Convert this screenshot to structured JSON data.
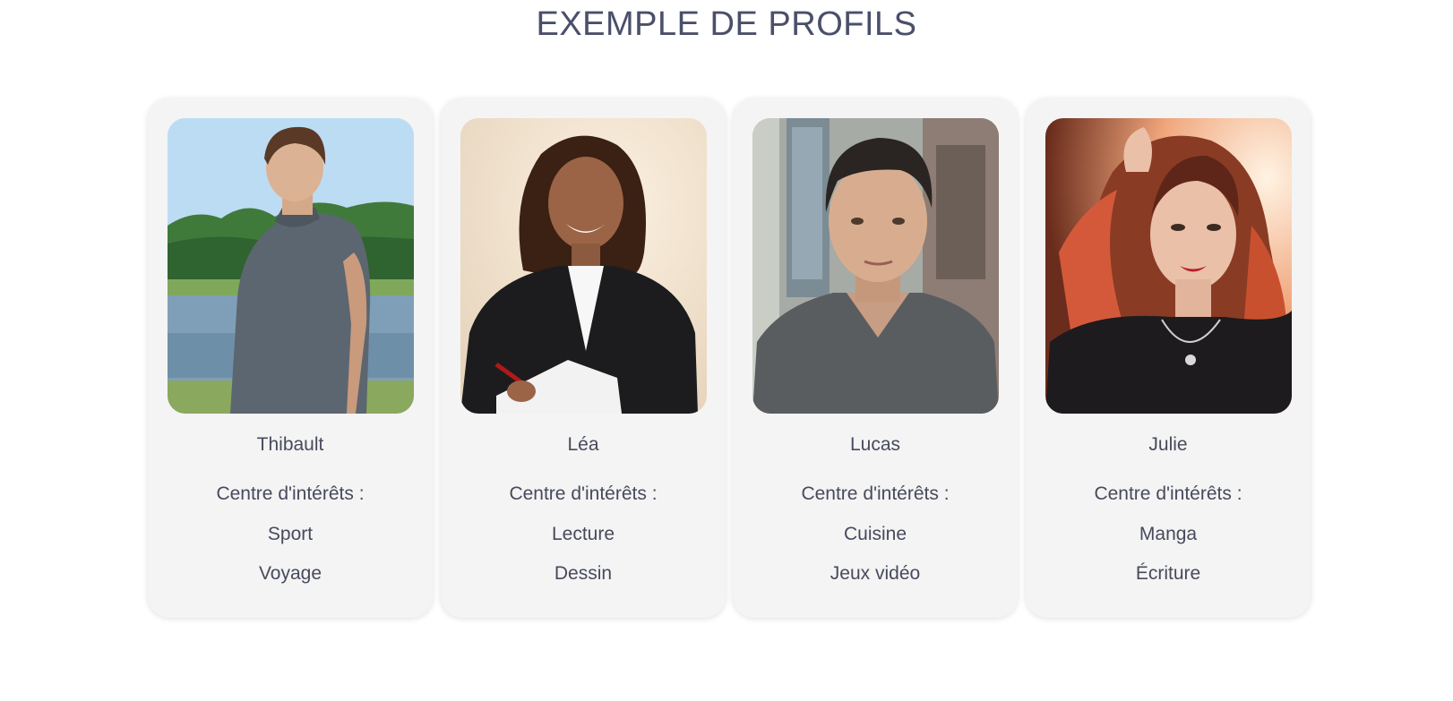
{
  "page": {
    "title": "EXEMPLE DE PROFILS"
  },
  "profiles": [
    {
      "name": "Thibault",
      "interests_label": "Centre d'intérêts :",
      "interests": [
        "Sport",
        "Voyage"
      ],
      "photo_icon": "profile-photo"
    },
    {
      "name": "Léa",
      "interests_label": "Centre d'intérêts :",
      "interests": [
        "Lecture",
        "Dessin"
      ],
      "photo_icon": "profile-photo"
    },
    {
      "name": "Lucas",
      "interests_label": "Centre d'intérêts :",
      "interests": [
        "Cuisine",
        "Jeux vidéo"
      ],
      "photo_icon": "profile-photo"
    },
    {
      "name": "Julie",
      "interests_label": "Centre d'intérêts :",
      "interests": [
        "Manga",
        "Écriture"
      ],
      "photo_icon": "profile-photo"
    }
  ],
  "colors": {
    "title": "#4a4f6a",
    "text": "#474a5c",
    "card_background": "#f4f4f4",
    "page_background": "#ffffff"
  }
}
